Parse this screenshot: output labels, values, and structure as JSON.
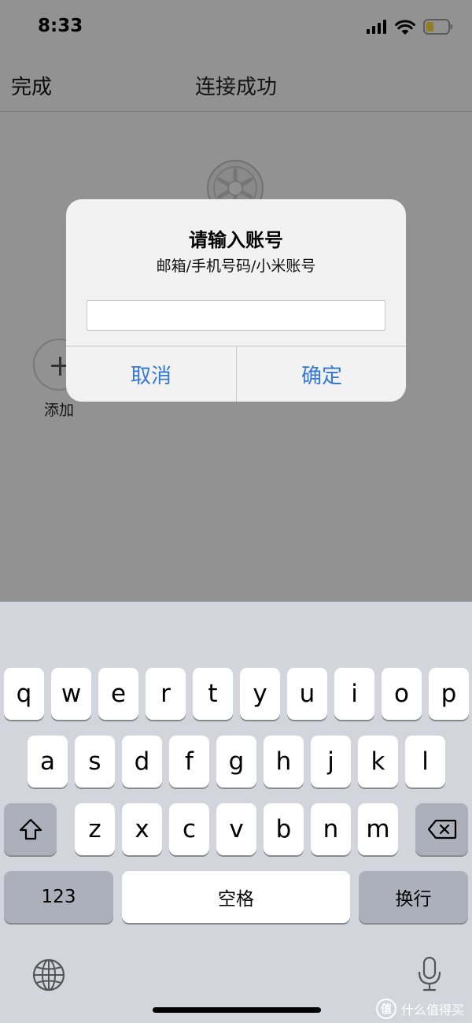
{
  "status_bar": {
    "time": "8:33"
  },
  "nav": {
    "done_label": "完成",
    "title": "连接成功"
  },
  "app": {
    "add_label": "添加"
  },
  "alert": {
    "title": "请输入账号",
    "message": "邮箱/手机号码/小米账号",
    "input_value": "",
    "cancel_label": "取消",
    "confirm_label": "确定"
  },
  "keyboard": {
    "row1": [
      "q",
      "w",
      "e",
      "r",
      "t",
      "y",
      "u",
      "i",
      "o",
      "p"
    ],
    "row2": [
      "a",
      "s",
      "d",
      "f",
      "g",
      "h",
      "j",
      "k",
      "l"
    ],
    "row3": [
      "z",
      "x",
      "c",
      "v",
      "b",
      "n",
      "m"
    ],
    "numbers_label": "123",
    "space_label": "空格",
    "return_label": "换行"
  },
  "watermark": {
    "text": "什么值得买",
    "logo_text": "值"
  },
  "colors": {
    "accent": "#3478d5",
    "keyboard_bg": "#d2d5db",
    "battery": "#f2d33a"
  }
}
